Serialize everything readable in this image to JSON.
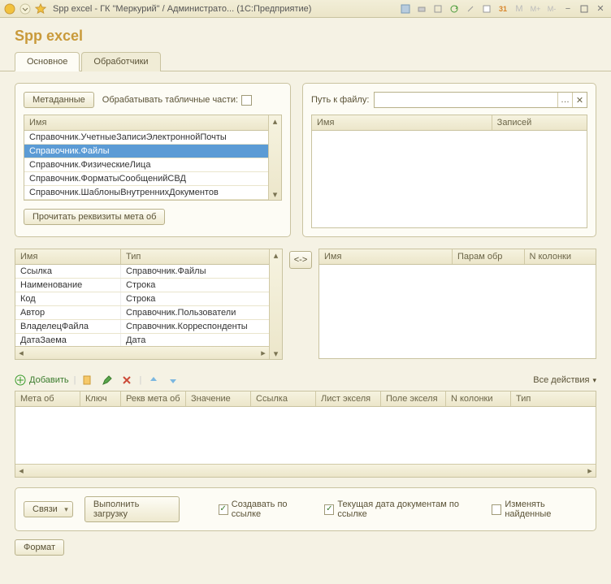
{
  "window": {
    "title": "Spp excel - ГК \"Меркурий\" / Администрато... (1С:Предприятие)"
  },
  "header": "Spp excel",
  "tabs": {
    "main": "Основное",
    "handlers": "Обработчики"
  },
  "left_panel": {
    "metadata_btn": "Метаданные",
    "process_tabular": "Обрабатывать табличные части:",
    "col_name": "Имя",
    "rows": [
      "Справочник.УчетныеЗаписиЭлектроннойПочты",
      "Справочник.Файлы",
      "Справочник.ФизическиеЛица",
      "Справочник.ФорматыСообщенийСВД",
      "Справочник.ШаблоныВнутреннихДокументов"
    ],
    "read_btn": "Прочитать реквизиты мета об"
  },
  "right_panel": {
    "path_label": "Путь к файлу:",
    "col_name": "Имя",
    "col_records": "Записей"
  },
  "attrs_table": {
    "col_name": "Имя",
    "col_type": "Тип",
    "rows": [
      {
        "n": "Ссылка",
        "t": "Справочник.Файлы"
      },
      {
        "n": "Наименование",
        "t": "Строка"
      },
      {
        "n": "Код",
        "t": "Строка"
      },
      {
        "n": "Автор",
        "t": "Справочник.Пользователи"
      },
      {
        "n": "ВладелецФайла",
        "t": "Справочник.Корреспонденты"
      },
      {
        "n": "ДатаЗаема",
        "t": "Дата"
      }
    ]
  },
  "swap_btn": "<->",
  "map_table": {
    "col_name": "Имя",
    "col_param": "Парам обр",
    "col_ncol": "N колонки"
  },
  "toolbar": {
    "add": "Добавить",
    "all_actions": "Все действия"
  },
  "grid": {
    "c1": "Мета об",
    "c2": "Ключ",
    "c3": "Рекв мета об",
    "c4": "Значение",
    "c5": "Ссылка",
    "c6": "Лист экселя",
    "c7": "Поле экселя",
    "c8": "N колонки",
    "c9": "Тип"
  },
  "bottom": {
    "links": "Связи",
    "load": "Выполнить загрузку",
    "create_by_ref": "Создавать по ссылке",
    "cur_date": "Текущая дата документам по ссылке",
    "change_found": "Изменять найденные",
    "format": "Формат"
  }
}
